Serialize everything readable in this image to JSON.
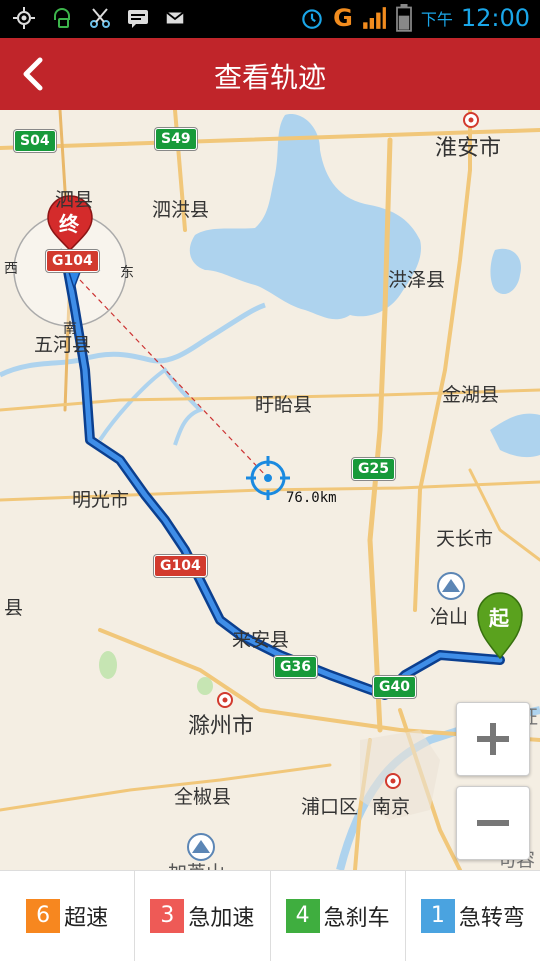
{
  "status_bar": {
    "ampm": "下午",
    "time": "12:00",
    "network": "G"
  },
  "header": {
    "title": "查看轨迹",
    "back_icon": "chevron-left-icon"
  },
  "map": {
    "places": {
      "huaian": "淮安市",
      "sixian": "泗县",
      "sihong": "泗洪县",
      "hongze": "洪泽县",
      "wuhe": "五河县",
      "xuyi": "盱眙县",
      "jinhu": "金湖县",
      "mingguang": "明光市",
      "tianchang": "天长市",
      "yeshan": "冶山",
      "laian": "来安县",
      "chuzhou": "滁州市",
      "quanjiao": "全椒县",
      "pukou": "浦口区",
      "nanjing": "南京",
      "left_edge": "县",
      "bottom_cut": "加芦山",
      "right_cut1": "仪征",
      "right_cut2": "句容"
    },
    "roads": {
      "s04": "S04",
      "s49": "S49",
      "g104_top": "G104",
      "g104": "G104",
      "g25": "G25",
      "g36": "G36",
      "g40": "G40"
    },
    "compass": {
      "west": "西",
      "east": "东",
      "south": "南"
    },
    "markers": {
      "start": "起",
      "end": "终"
    },
    "distance": "76.0km",
    "zoom_in": "+",
    "zoom_out": "−"
  },
  "legend": [
    {
      "count": "6",
      "label": "超速",
      "color": "#f7871f"
    },
    {
      "count": "3",
      "label": "急加速",
      "color": "#ee5a56"
    },
    {
      "count": "4",
      "label": "急刹车",
      "color": "#3fae3f"
    },
    {
      "count": "1",
      "label": "急转弯",
      "color": "#4aa3e0"
    }
  ],
  "colors": {
    "header_bg": "#c0252a",
    "route": "#1f6fd6",
    "water": "#aed3ee"
  }
}
